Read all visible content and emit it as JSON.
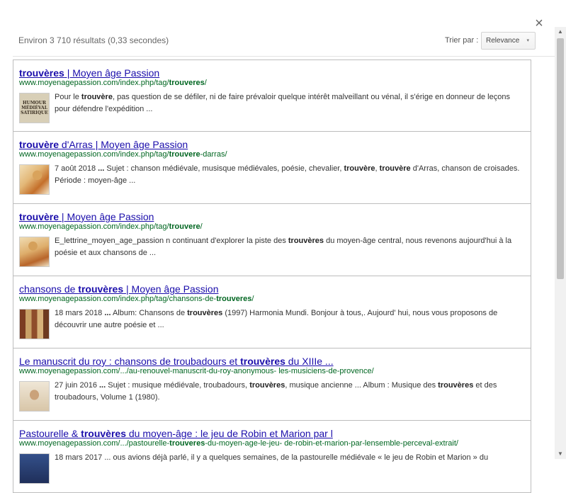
{
  "dialog": {
    "close_glyph": "×"
  },
  "header": {
    "results_count": "Environ 3 710 résultats (0,33 secondes)",
    "sort_label": "Trier par :",
    "sort_value": "Relevance",
    "sort_arrow": "▾"
  },
  "results": [
    {
      "title_parts": [
        {
          "b": "trouvères"
        },
        {
          "t": " | Moyen âge Passion"
        }
      ],
      "url_parts": [
        {
          "t": "www.moyenagepassion.com/index.php/tag/"
        },
        {
          "b": "trouveres"
        },
        {
          "t": "/"
        }
      ],
      "thumb_text": [
        "HUMOUR",
        "MÉDIÉVAL",
        "SATIRIQUE"
      ],
      "snippet_parts": [
        {
          "t": "Pour le "
        },
        {
          "b": "trouvère"
        },
        {
          "t": ", pas question de se défiler, ni de faire prévaloir quelque intérêt malveillant ou vénal, il s'érige en donneur de leçons pour défendre l'expédition ..."
        }
      ]
    },
    {
      "title_parts": [
        {
          "b": "trouvère"
        },
        {
          "t": " d'Arras | Moyen âge Passion"
        }
      ],
      "url_parts": [
        {
          "t": "www.moyenagepassion.com/index.php/tag/"
        },
        {
          "b": "trouvere"
        },
        {
          "t": "-darras/"
        }
      ],
      "snippet_parts": [
        {
          "t": "7 août 2018 "
        },
        {
          "b": "..."
        },
        {
          "t": " Sujet : chanson médiévale, musisque médiévales, poésie, chevalier, "
        },
        {
          "b": "trouvère"
        },
        {
          "t": ", "
        },
        {
          "b": "trouvère"
        },
        {
          "t": " d'Arras, chanson de croisades. Période : moyen-âge ..."
        }
      ]
    },
    {
      "title_parts": [
        {
          "b": "trouvère"
        },
        {
          "t": " | Moyen âge Passion"
        }
      ],
      "url_parts": [
        {
          "t": "www.moyenagepassion.com/index.php/tag/"
        },
        {
          "b": "trouvere"
        },
        {
          "t": "/"
        }
      ],
      "snippet_parts": [
        {
          "t": "E_lettrine_moyen_age_passion n continuant d'explorer la piste des "
        },
        {
          "b": "trouvères"
        },
        {
          "t": " du moyen-âge central, nous revenons aujourd'hui à la poésie et aux chansons de ..."
        }
      ]
    },
    {
      "title_parts": [
        {
          "t": "chansons de "
        },
        {
          "b": "trouvères"
        },
        {
          "t": " | Moyen âge Passion"
        }
      ],
      "url_parts": [
        {
          "t": "www.moyenagepassion.com/index.php/tag/chansons-de-"
        },
        {
          "b": "trouveres"
        },
        {
          "t": "/"
        }
      ],
      "snippet_parts": [
        {
          "t": "18 mars 2018 "
        },
        {
          "b": "..."
        },
        {
          "t": " Album: Chansons de "
        },
        {
          "b": "trouvères"
        },
        {
          "t": " (1997) Harmonia Mundi. Bonjour à tous,. Aujourd' hui, nous vous proposons de découvrir une autre poésie et ..."
        }
      ]
    },
    {
      "title_parts": [
        {
          "t": "Le manuscrit du roy : chansons de troubadours et "
        },
        {
          "b": "trouvères"
        },
        {
          "t": " du XIIIe ..."
        }
      ],
      "url_parts": [
        {
          "t": "www.moyenagepassion.com/.../au-renouvel-manuscrit-du-roy-anonymous- les-musiciens-de-provence/"
        }
      ],
      "snippet_parts": [
        {
          "t": "27 juin 2016 "
        },
        {
          "b": "..."
        },
        {
          "t": " Sujet : musique médiévale, troubadours, "
        },
        {
          "b": "trouvères"
        },
        {
          "t": ", musique ancienne ... Album : Musique des "
        },
        {
          "b": "trouvères"
        },
        {
          "t": " et des troubadours, Volume 1 (1980)."
        }
      ]
    },
    {
      "title_parts": [
        {
          "t": "Pastourelle & "
        },
        {
          "b": "trouvères"
        },
        {
          "t": " du moyen-âge : le jeu de Robin et Marion par l"
        }
      ],
      "url_parts": [
        {
          "t": "www.moyenagepassion.com/.../pastourelle-"
        },
        {
          "b": "trouveres"
        },
        {
          "t": "-du-moyen-age-le-jeu- de-robin-et-marion-par-lensemble-perceval-extrait/"
        }
      ],
      "snippet_parts": [
        {
          "t": "18 mars 2017 ... ous avions déjà parlé, il y a quelques semaines, de la pastourelle médiévale « le jeu de Robin et Marion » du"
        }
      ]
    }
  ],
  "scrollbar": {
    "up": "▲",
    "down": "▼"
  }
}
